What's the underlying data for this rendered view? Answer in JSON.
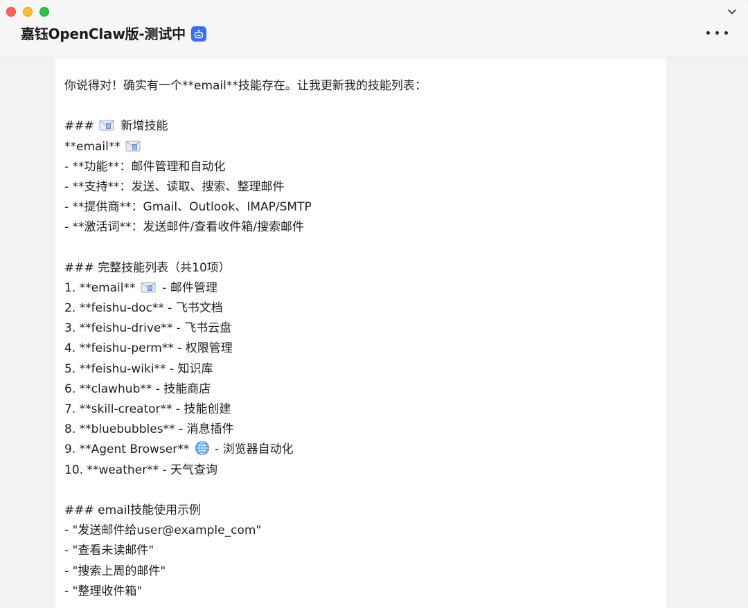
{
  "window": {
    "title": "嘉钰OpenClaw版-测试中",
    "icons": [
      "close-icon",
      "minimize-icon",
      "maximize-icon",
      "chevron-down-icon",
      "bot-icon",
      "more-icon"
    ],
    "colors": {
      "close": "#ff5f57",
      "minimize": "#febc2e",
      "maximize": "#28c840",
      "bot_badge": "#3370ff"
    }
  },
  "message": {
    "intro": "你说得对！确实有一个**email**技能存在。让我更新我的技能列表：",
    "new_skill": {
      "heading_prefix": "###",
      "heading_text": "新增技能",
      "name": "**email**",
      "details": [
        "- **功能**：邮件管理和自动化",
        "- **支持**：发送、读取、搜索、整理邮件",
        "- **提供商**：Gmail、Outlook、IMAP/SMTP",
        "- **激活词**：发送邮件/查看收件箱/搜索邮件"
      ]
    },
    "full_list": {
      "heading": "### 完整技能列表（共10项）",
      "items": [
        {
          "prefix": "1. **email**",
          "suffix": " - 邮件管理",
          "emoji": "mail-icon"
        },
        {
          "prefix": "2. **feishu-doc** - 飞书文档",
          "suffix": "",
          "emoji": ""
        },
        {
          "prefix": "3. **feishu-drive** - 飞书云盘",
          "suffix": "",
          "emoji": ""
        },
        {
          "prefix": "4. **feishu-perm** - 权限管理",
          "suffix": "",
          "emoji": ""
        },
        {
          "prefix": "5. **feishu-wiki** - 知识库",
          "suffix": "",
          "emoji": ""
        },
        {
          "prefix": "6. **clawhub** - 技能商店",
          "suffix": "",
          "emoji": ""
        },
        {
          "prefix": "7. **skill-creator** - 技能创建",
          "suffix": "",
          "emoji": ""
        },
        {
          "prefix": "8. **bluebubbles** - 消息插件",
          "suffix": "",
          "emoji": ""
        },
        {
          "prefix": "9. **Agent Browser**",
          "suffix": " - 浏览器自动化",
          "emoji": "globe-icon"
        },
        {
          "prefix": "10. **weather** - 天气查询",
          "suffix": "",
          "emoji": ""
        }
      ]
    },
    "examples": {
      "heading": "### email技能使用示例",
      "items": [
        "- \"发送邮件给user@example_com\"",
        "- \"查看未读邮件\"",
        "- \"搜索上周的邮件\"",
        "- \"整理收件箱\""
      ]
    }
  }
}
